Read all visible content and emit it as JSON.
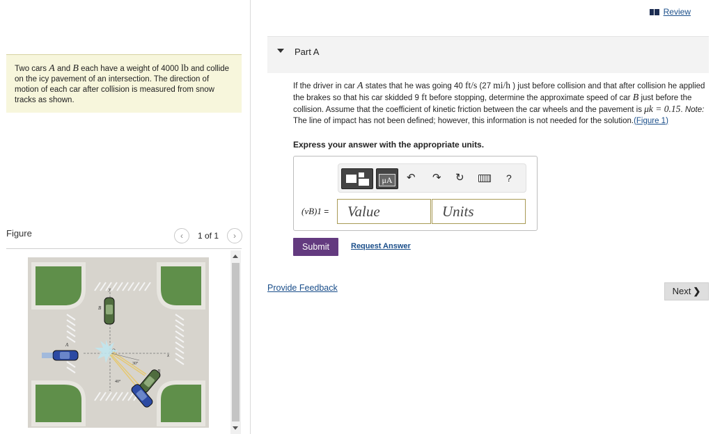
{
  "header": {
    "review_label": "Review",
    "review_icon": "book-icon"
  },
  "problem": {
    "text_1": "Two cars ",
    "var_a": "A",
    "text_2": " and ",
    "var_b": "B",
    "text_3": " each have a weight of 4000 ",
    "unit_lb": "lb",
    "text_4": " and collide on the icy pavement of an intersection. The direction of motion of each car after collision is measured from snow tracks as shown."
  },
  "figure": {
    "label": "Figure",
    "count": "1 of 1",
    "prev_icon": "chevron-left-icon",
    "next_icon": "chevron-right-icon",
    "diagram_labels": {
      "y": "y",
      "x": "x",
      "origin": "O",
      "car_a": "A",
      "car_b_before": "B",
      "car_b_after": "B",
      "angle_30": "30°",
      "angle_40": "40°"
    }
  },
  "part": {
    "title": "Part A",
    "q1": "If the driver in car ",
    "q_var_a": "A",
    "q2": " states that he was going 40 ",
    "q_unit1": "ft/s",
    "q3": " (27 ",
    "q_unit2": "mi/h",
    "q4": " ) just before collision and that after collision he applied the brakes so that his car skidded 9 ",
    "q_unit3": "ft",
    "q5": " before stopping, determine the approximate speed of car ",
    "q_var_b": "B",
    "q6": " just before the collision. Assume that the coefficient of kinetic friction between the car wheels and the pavement is ",
    "q_mu": "μk = 0.15",
    "q7": ". ",
    "q_note": "Note:",
    "q8": " The line of impact has not been defined; however, this information is not needed for the solution.",
    "q_fig_link": "(Figure 1)",
    "instruction": "Express your answer with the appropriate units."
  },
  "answer": {
    "label_var": "(vB)1",
    "label_eq": " = ",
    "value_placeholder": "Value",
    "units_placeholder": "Units",
    "toolbar": {
      "units_symbol": "μA",
      "undo": "↶",
      "redo": "↷",
      "reset": "↻",
      "help": "?"
    }
  },
  "actions": {
    "submit": "Submit",
    "request_answer": "Request Answer",
    "provide_feedback": "Provide Feedback",
    "next": "Next",
    "next_chevron": "❯"
  },
  "colors": {
    "submit_bg": "#633a7f",
    "problem_bg": "#f7f6dc",
    "link": "#1a4e8a"
  }
}
